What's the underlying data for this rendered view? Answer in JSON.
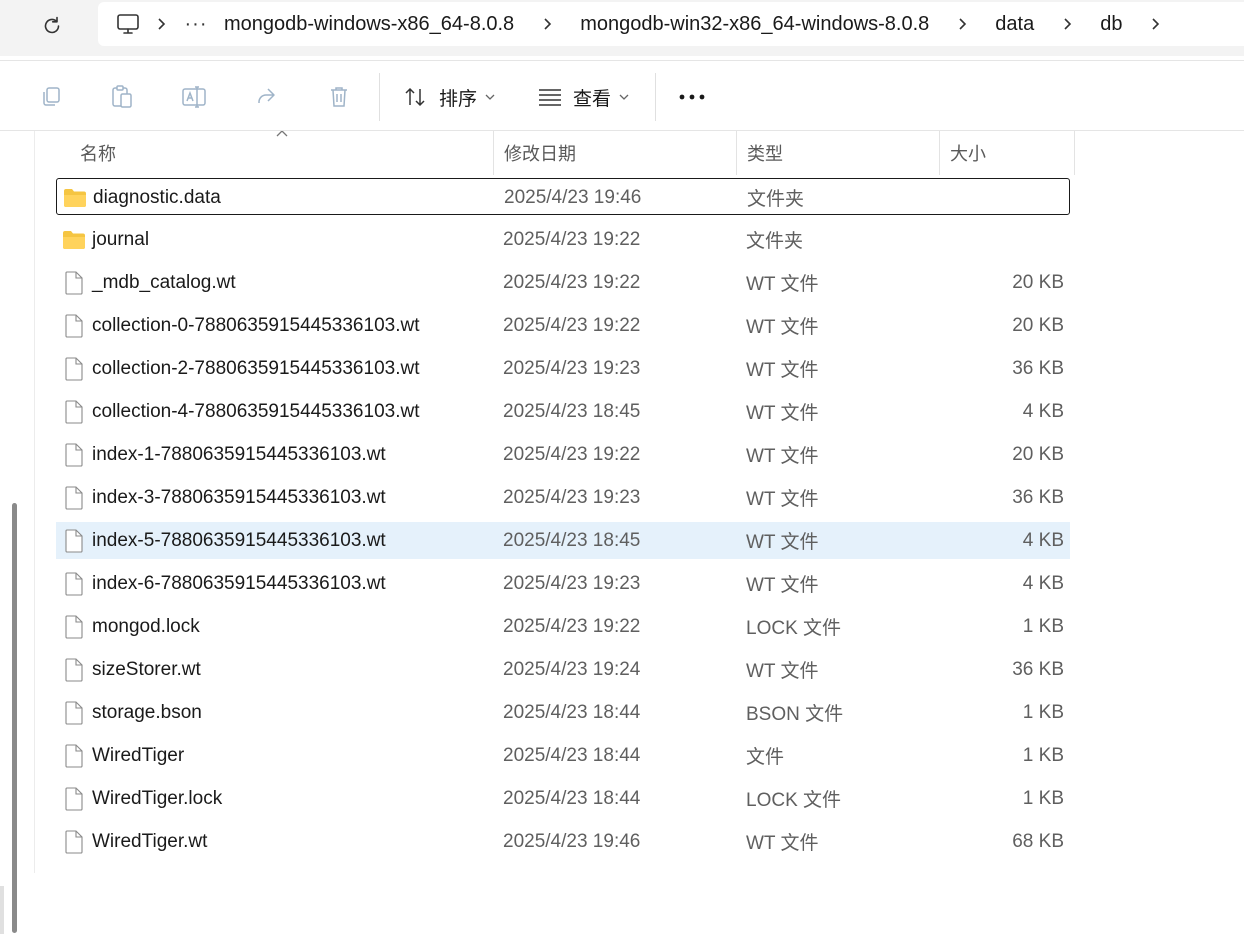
{
  "address_bar": {
    "breadcrumbs": [
      "mongodb-windows-x86_64-8.0.8",
      "mongodb-win32-x86_64-windows-8.0.8",
      "data",
      "db"
    ],
    "more_label": "···"
  },
  "toolbar": {
    "sort_label": "排序",
    "view_label": "查看",
    "more_label": "···"
  },
  "columns": {
    "name": "名称",
    "modified": "修改日期",
    "type": "类型",
    "size": "大小"
  },
  "files": [
    {
      "name": "diagnostic.data",
      "modified": "2025/4/23 19:46",
      "type": "文件夹",
      "size": "",
      "icon": "folder-icon"
    },
    {
      "name": "journal",
      "modified": "2025/4/23 19:22",
      "type": "文件夹",
      "size": "",
      "icon": "folder-icon"
    },
    {
      "name": "_mdb_catalog.wt",
      "modified": "2025/4/23 19:22",
      "type": "WT 文件",
      "size": "20 KB",
      "icon": "file-icon"
    },
    {
      "name": "collection-0-7880635915445336103.wt",
      "modified": "2025/4/23 19:22",
      "type": "WT 文件",
      "size": "20 KB",
      "icon": "file-icon"
    },
    {
      "name": "collection-2-7880635915445336103.wt",
      "modified": "2025/4/23 19:23",
      "type": "WT 文件",
      "size": "36 KB",
      "icon": "file-icon"
    },
    {
      "name": "collection-4-7880635915445336103.wt",
      "modified": "2025/4/23 18:45",
      "type": "WT 文件",
      "size": "4 KB",
      "icon": "file-icon"
    },
    {
      "name": "index-1-7880635915445336103.wt",
      "modified": "2025/4/23 19:22",
      "type": "WT 文件",
      "size": "20 KB",
      "icon": "file-icon"
    },
    {
      "name": "index-3-7880635915445336103.wt",
      "modified": "2025/4/23 19:23",
      "type": "WT 文件",
      "size": "36 KB",
      "icon": "file-icon"
    },
    {
      "name": "index-5-7880635915445336103.wt",
      "modified": "2025/4/23 18:45",
      "type": "WT 文件",
      "size": "4 KB",
      "icon": "file-icon"
    },
    {
      "name": "index-6-7880635915445336103.wt",
      "modified": "2025/4/23 19:23",
      "type": "WT 文件",
      "size": "4 KB",
      "icon": "file-icon"
    },
    {
      "name": "mongod.lock",
      "modified": "2025/4/23 19:22",
      "type": "LOCK 文件",
      "size": "1 KB",
      "icon": "file-icon"
    },
    {
      "name": "sizeStorer.wt",
      "modified": "2025/4/23 19:24",
      "type": "WT 文件",
      "size": "36 KB",
      "icon": "file-icon"
    },
    {
      "name": "storage.bson",
      "modified": "2025/4/23 18:44",
      "type": "BSON 文件",
      "size": "1 KB",
      "icon": "file-icon"
    },
    {
      "name": "WiredTiger",
      "modified": "2025/4/23 18:44",
      "type": "文件",
      "size": "1 KB",
      "icon": "file-icon"
    },
    {
      "name": "WiredTiger.lock",
      "modified": "2025/4/23 18:44",
      "type": "LOCK 文件",
      "size": "1 KB",
      "icon": "file-icon"
    },
    {
      "name": "WiredTiger.wt",
      "modified": "2025/4/23 19:46",
      "type": "WT 文件",
      "size": "68 KB",
      "icon": "file-icon"
    }
  ],
  "focused_row": 0,
  "hovered_row": 8,
  "colors": {
    "folder": "#f5c542",
    "hover": "#e5f1fb",
    "toolbar_icon_disabled": "#9fb4c8"
  }
}
